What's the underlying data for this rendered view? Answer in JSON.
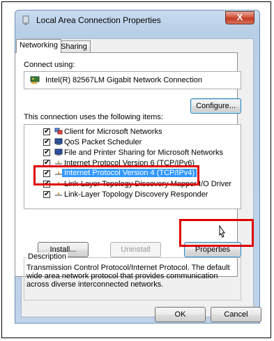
{
  "window": {
    "title": "Local Area Connection Properties",
    "close_label": "X"
  },
  "tabs": [
    {
      "label": "Networking",
      "selected": true
    },
    {
      "label": "Sharing",
      "selected": false
    }
  ],
  "connect_using_label": "Connect using:",
  "adapter": "Intel(R) 82567LM Gigabit Network Connection",
  "configure_label": "Configure...",
  "items_label": "This connection uses the following items:",
  "items": [
    {
      "label": "Client for Microsoft Networks",
      "checked": true,
      "icon": "network-client-icon"
    },
    {
      "label": "QoS Packet Scheduler",
      "checked": true,
      "icon": "service-icon"
    },
    {
      "label": "File and Printer Sharing for Microsoft Networks",
      "checked": true,
      "icon": "service-icon"
    },
    {
      "label": "Internet Protocol Version 6 (TCP/IPv6)",
      "checked": true,
      "icon": "protocol-icon"
    },
    {
      "label": "Internet Protocol Version 4 (TCP/IPv4)",
      "checked": true,
      "icon": "protocol-icon",
      "selected": true
    },
    {
      "label": "Link-Layer Topology Discovery Mapper I/O Driver",
      "checked": true,
      "icon": "protocol-icon"
    },
    {
      "label": "Link-Layer Topology Discovery Responder",
      "checked": true,
      "icon": "protocol-icon"
    }
  ],
  "buttons": {
    "install": "Install...",
    "uninstall": "Uninstall",
    "properties": "Properties",
    "ok": "OK",
    "cancel": "Cancel"
  },
  "description": {
    "title": "Description",
    "text": "Transmission Control Protocol/Internet Protocol. The default wide area network protocol that provides communication across diverse interconnected networks."
  },
  "colors": {
    "highlight": "#e00000",
    "selection": "#3399ff"
  }
}
